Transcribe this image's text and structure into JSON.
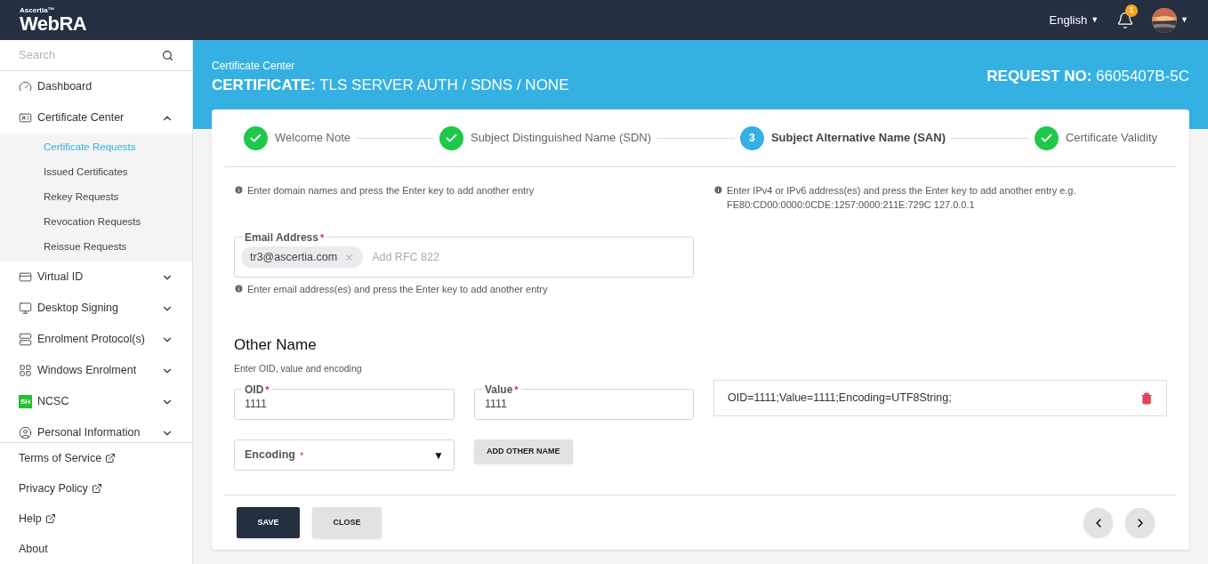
{
  "topbar": {
    "logo_small": "Ascertia™",
    "logo": "WebRA",
    "language": "English",
    "notifications": "1"
  },
  "sidebar": {
    "search": {
      "placeholder": "Search"
    },
    "items": [
      {
        "label": "Dashboard",
        "has_children": false
      },
      {
        "label": "Certificate Center",
        "expanded": true,
        "has_children": true,
        "children": [
          {
            "label": "Certificate Requests",
            "selected": true
          },
          {
            "label": "Issued Certificates",
            "selected": false
          },
          {
            "label": "Rekey Requests",
            "selected": false
          },
          {
            "label": "Revocation Requests",
            "selected": false
          },
          {
            "label": "Reissue Requests",
            "selected": false
          }
        ]
      },
      {
        "label": "Virtual ID",
        "expanded": false,
        "has_children": true
      },
      {
        "label": "Desktop Signing",
        "expanded": false,
        "has_children": true
      },
      {
        "label": "Enrolment Protocol(s)",
        "expanded": false,
        "has_children": true
      },
      {
        "label": "Windows Enrolment",
        "expanded": false,
        "has_children": true
      },
      {
        "label": "NCSC",
        "badge_text": "SH",
        "expanded": false,
        "has_children": true
      },
      {
        "label": "Personal Information",
        "expanded": false,
        "has_children": true
      }
    ],
    "footer_links": [
      {
        "label": "Terms of Service",
        "external": true
      },
      {
        "label": "Privacy Policy",
        "external": true
      },
      {
        "label": "Help",
        "external": true
      },
      {
        "label": "About",
        "external": false
      }
    ]
  },
  "header": {
    "breadcrumb": "Certificate Center",
    "title_prefix": "CERTIFICATE:",
    "title": "TLS SERVER AUTH / SDNS / NONE",
    "request_prefix": "REQUEST NO:",
    "request_no": "6605407B-5C"
  },
  "steps": [
    {
      "label": "Welcome Note",
      "completed": true
    },
    {
      "label": "Subject Distinguished Name (SDN)",
      "completed": true
    },
    {
      "label": "Subject Alternative Name (SAN)",
      "completed": false,
      "number": "3"
    },
    {
      "label": "Certificate Validity",
      "completed": true
    }
  ],
  "hints": {
    "domain": "Enter domain names and press the Enter key to add another entry",
    "ip": "Enter IPv4 or IPv6 address(es) and press the Enter key to add another entry e.g. FE80:CD00:0000:0CDE:1257:0000:211E:729C 127.0.0.1"
  },
  "email": {
    "label": "Email Address",
    "required_mark": "*",
    "chips": [
      "tr3@ascertia.com"
    ],
    "placeholder": "Add RFC 822",
    "hint": "Enter email address(es) and press the Enter key to add another entry"
  },
  "other_name": {
    "title": "Other Name",
    "subtitle": "Enter OID, value and encoding",
    "oid": {
      "label": "OID",
      "required_mark": "*",
      "value": "1111"
    },
    "value": {
      "label": "Value",
      "required_mark": "*",
      "value": "1111"
    },
    "encoding": {
      "label": "Encoding",
      "required_mark": "*",
      "arrow": "▼"
    },
    "add_button": "ADD OTHER NAME",
    "entries": [
      "OID=1111;Value=1111;Encoding=UTF8String;"
    ]
  },
  "buttons": {
    "save": "SAVE",
    "close": "CLOSE"
  }
}
